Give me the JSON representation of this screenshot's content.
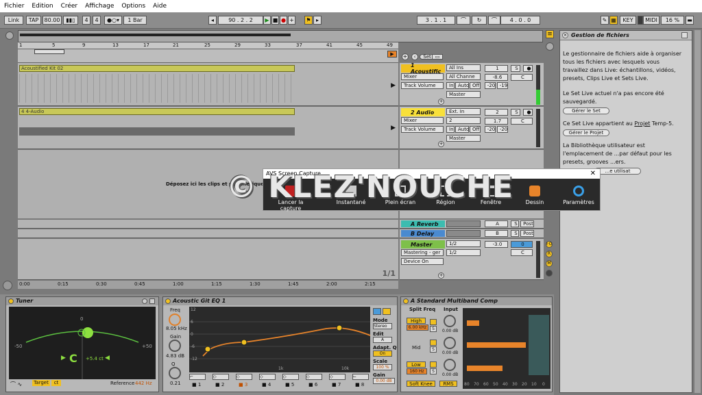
{
  "menu": [
    "Fichier",
    "Edition",
    "Créer",
    "Affichage",
    "Options",
    "Aide"
  ],
  "transport": {
    "link": "Link",
    "tap": "TAP",
    "tempo": "80.00",
    "sig_num": "4",
    "sig_den": "4",
    "quant": "1 Bar",
    "position": "90 . 2 . 2",
    "loop_start": "3 . 1 . 1",
    "loop_len": "4 . 0 . 0",
    "key": "KEY",
    "midi": "MIDI",
    "cpu": "16 %"
  },
  "ruler": [
    "1",
    "5",
    "9",
    "13",
    "17",
    "21",
    "25",
    "29",
    "33",
    "37",
    "41",
    "45",
    "49"
  ],
  "timeline": [
    "0:00",
    "0:15",
    "0:30",
    "0:45",
    "1:00",
    "1:15",
    "1:30",
    "1:45",
    "2:00",
    "2:15"
  ],
  "page_count": "1/1",
  "set_label": "Set",
  "drop_hint": "Déposez ici les clips et périphériques",
  "tracks": [
    {
      "clip": "Acoustified Kit 02",
      "name": "1 Acoustific",
      "num": "1",
      "input": "All Ins",
      "channel": "All Channe",
      "mixer": "Mixer",
      "volume": "Track Volume",
      "out": "Master",
      "val": "-8.6",
      "pan": "C",
      "l": "-20",
      "r": "-19",
      "mon": [
        "In",
        "Auto",
        "Off"
      ]
    },
    {
      "clip": "4 4-Audio",
      "name": "2 Audio",
      "num": "2",
      "input": "Ext. In",
      "channel": "2",
      "mixer": "Mixer",
      "volume": "Track Volume",
      "out": "Master",
      "val": "1.7",
      "pan": "C",
      "l": "-20",
      "r": "-20",
      "mon": [
        "In",
        "Auto",
        "Off"
      ]
    }
  ],
  "returns": [
    {
      "name": "A Reverb",
      "letter": "A",
      "post": "Post"
    },
    {
      "name": "B Delay",
      "letter": "B",
      "post": "Post"
    }
  ],
  "master": {
    "name": "Master",
    "mixer": "Mastering - ger",
    "device": "Device On",
    "io": "1/2",
    "val": "-3.0",
    "cue": "0",
    "pan": "C"
  },
  "browser": {
    "title": "Gestion de fichiers",
    "p1": "Le gestionnaire de fichiers aide à organiser tous les fichiers avec lesquels vous travaillez dans Live: échantillons, vidéos, presets, Clips Live et Sets Live.",
    "p2": "Le Set Live actuel n'a pas encore été sauvegardé.",
    "b1": "Gérer le Set",
    "p3_a": "Ce Set Live appartient au ",
    "p3_link": "Projet",
    "p3_b": " Temp-5.",
    "b2": "Gérer le Projet",
    "p4": "La Bibliothèque utilisateur est l'emplacement de ...par défaut pour les presets, grooves ...ers.",
    "b3": "...e utilisat"
  },
  "dialog": {
    "title": "AVS Screen Capture",
    "items": [
      "Lancer la capture",
      "Instantané",
      "Plein écran",
      "Région",
      "Fenêtre",
      "Dessin",
      "Paramètres"
    ]
  },
  "watermark": "© KLEZ'NOUCHE",
  "tuner": {
    "title": "Tuner",
    "note": "C",
    "cents": "+5.4 ct",
    "target": "Target",
    "ct": "ct",
    "ref_label": "Reference",
    "ref": "442 Hz",
    "zero": "0",
    "m50": "-50",
    "p50": "+50"
  },
  "eq": {
    "title": "Acoustic Git EQ 1",
    "freq_l": "Freq",
    "freq": "8.05 kHz",
    "gain_l": "Gain",
    "gain": "4.83 dB",
    "q_l": "Q",
    "q": "0.21",
    "mode_l": "Mode",
    "mode": "Stereo",
    "edit_l": "Edit",
    "edit": "A",
    "adapt_l": "Adapt. Q",
    "adapt": "On",
    "scale_l": "Scale",
    "scale": "100 %",
    "gain2_l": "Gain",
    "gain2": "0.00 dB",
    "bands": [
      "1",
      "2",
      "3",
      "4",
      "5",
      "6",
      "7",
      "8"
    ],
    "db": [
      "12",
      "6",
      "0",
      "-6",
      "-12"
    ],
    "fx": [
      "1k",
      "10k"
    ]
  },
  "comp": {
    "title": "A Standard Multiband Comp",
    "split": "Split Freq",
    "input": "Input",
    "high": "High",
    "hf": "6.00 kHz",
    "mid": "Mid",
    "low": "Low",
    "lf": "160 Hz",
    "soft": "Soft Knee",
    "rms": "RMS",
    "db": "0.00 dB",
    "scale": [
      "80",
      "70",
      "60",
      "50",
      "40",
      "30",
      "20",
      "10",
      "0"
    ]
  }
}
